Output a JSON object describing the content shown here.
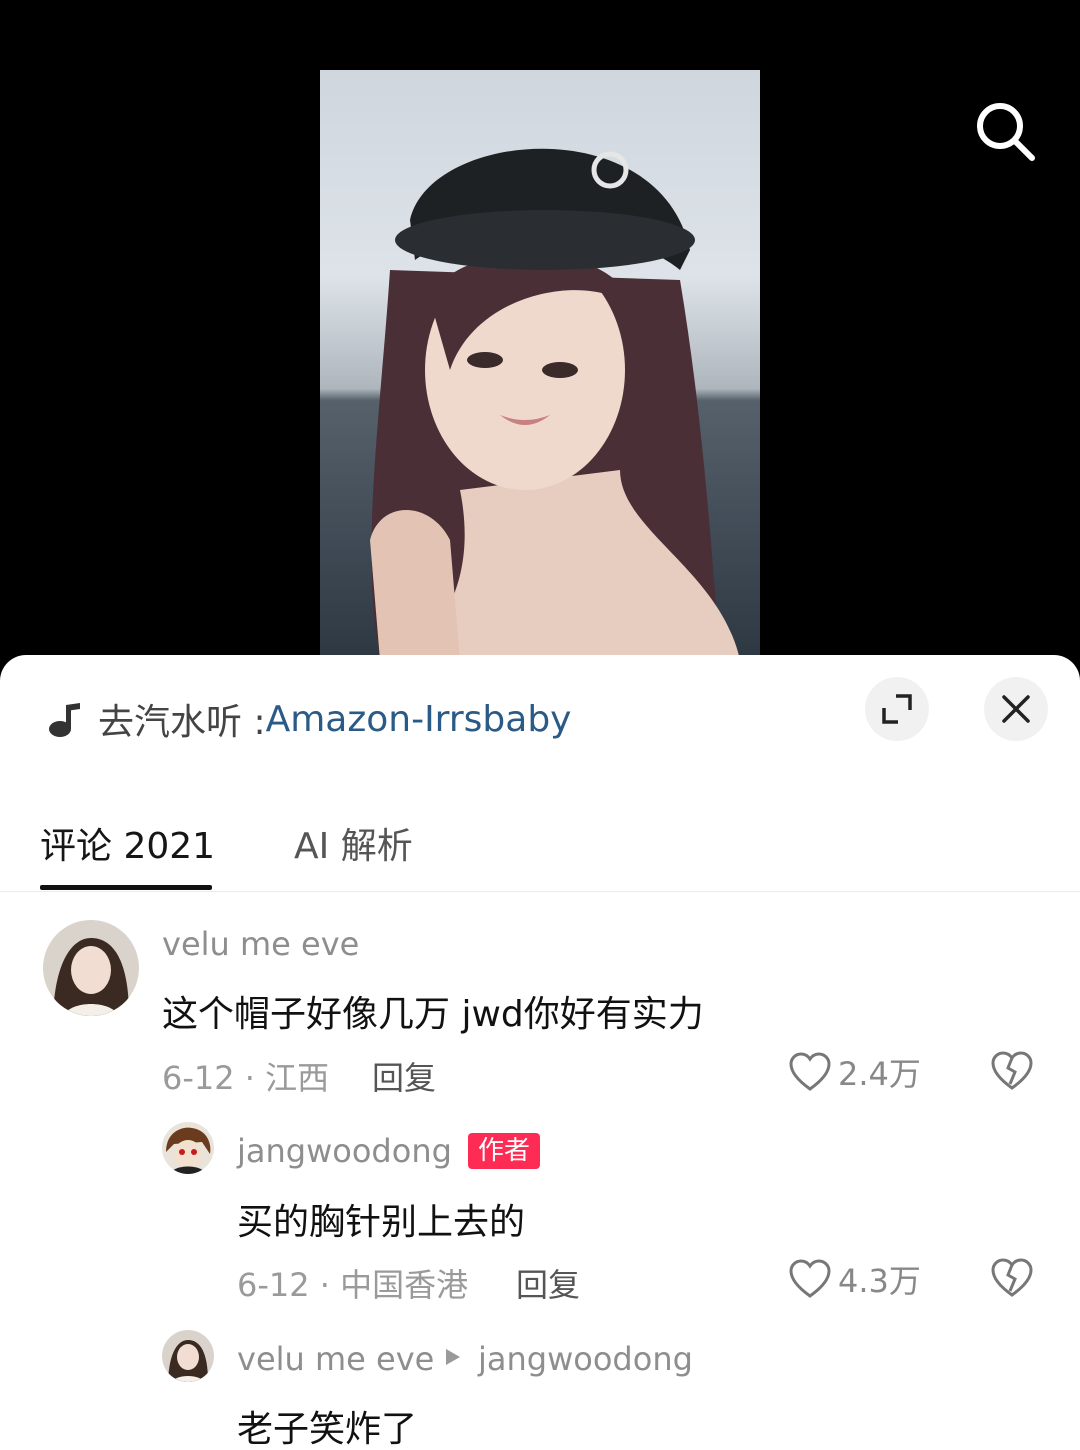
{
  "music": {
    "prefix": "去汽水听 :",
    "title": "Amazon-Irrsbaby"
  },
  "tabs": {
    "comments_label": "评论 2021",
    "ai_label": "AI 解析"
  },
  "comments": [
    {
      "user": "velu me eve",
      "text": "这个帽子好像几万 jwd你好有实力",
      "meta": "6-12 · 江西",
      "reply_label": "回复",
      "likes": "2.4万"
    },
    {
      "user": "jangwoodong",
      "badge": "作者",
      "text": "买的胸针别上去的",
      "meta": "6-12 · 中国香港",
      "reply_label": "回复",
      "likes": "4.3万"
    },
    {
      "user": "velu me eve",
      "reply_to": "jangwoodong",
      "text": "老子笑炸了"
    }
  ],
  "colors": {
    "accent_badge": "#fe2c55",
    "music_link": "#2a5a86"
  }
}
